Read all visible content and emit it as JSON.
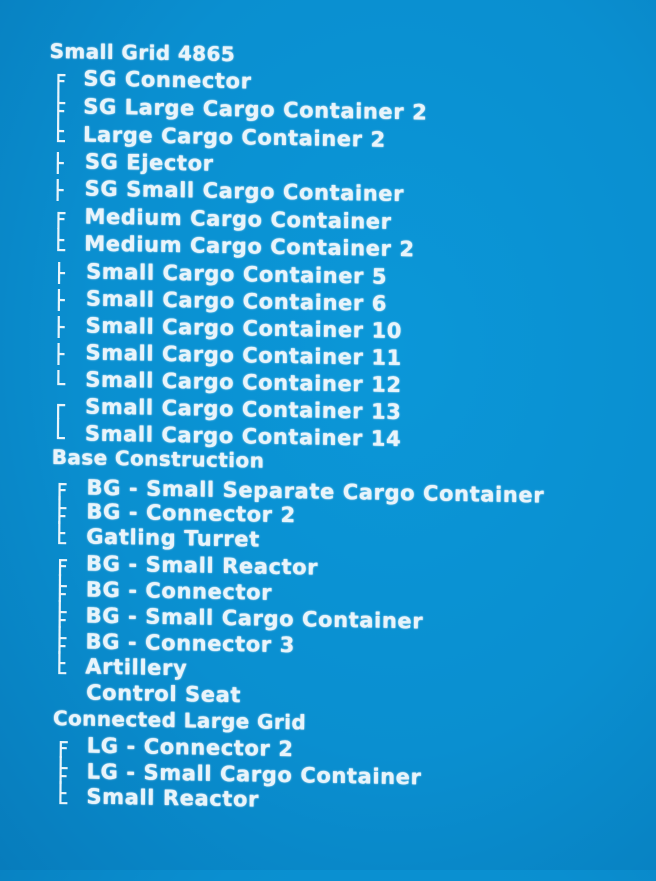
{
  "grids": [
    {
      "name": "Small Grid 4865",
      "blocks": [
        {
          "label": "SG Connector",
          "connector": "open"
        },
        {
          "label": "SG Large Cargo Container 2",
          "connector": "mid"
        },
        {
          "label": "Large Cargo Container 2",
          "connector": "close"
        },
        {
          "label": "SG Ejector",
          "connector": "tee"
        },
        {
          "label": "SG Small Cargo Container",
          "connector": "tee"
        },
        {
          "label": "Medium Cargo Container",
          "connector": "open"
        },
        {
          "label": "Medium Cargo Container 2",
          "connector": "close"
        },
        {
          "label": "Small Cargo Container 5",
          "connector": "tee"
        },
        {
          "label": "Small Cargo Container 6",
          "connector": "tee"
        },
        {
          "label": "Small Cargo Container 10",
          "connector": "tee"
        },
        {
          "label": "Small Cargo Container 11",
          "connector": "tee"
        },
        {
          "label": "Small Cargo Container 12",
          "connector": "end"
        },
        {
          "label": "Small Cargo Container 13",
          "connector": "open"
        },
        {
          "label": "Small Cargo Container 14",
          "connector": "end"
        }
      ]
    },
    {
      "name": "Base Construction",
      "blocks": [
        {
          "label": "BG - Small Separate Cargo Container",
          "connector": "open"
        },
        {
          "label": "BG - Connector 2",
          "connector": "mid"
        },
        {
          "label": "Gatling Turret",
          "connector": "close"
        },
        {
          "label": "BG - Small Reactor",
          "connector": "open"
        },
        {
          "label": "BG - Connector",
          "connector": "mid"
        },
        {
          "label": "BG - Small Cargo Container",
          "connector": "mid"
        },
        {
          "label": "BG - Connector 3",
          "connector": "mid"
        },
        {
          "label": "Artillery",
          "connector": "close"
        },
        {
          "label": "Control Seat",
          "connector": "none"
        }
      ]
    },
    {
      "name": "Connected Large Grid",
      "blocks": [
        {
          "label": "LG - Connector 2",
          "connector": "open"
        },
        {
          "label": "LG - Small Cargo Container",
          "connector": "mid"
        },
        {
          "label": "Small Reactor",
          "connector": "close"
        }
      ]
    }
  ]
}
